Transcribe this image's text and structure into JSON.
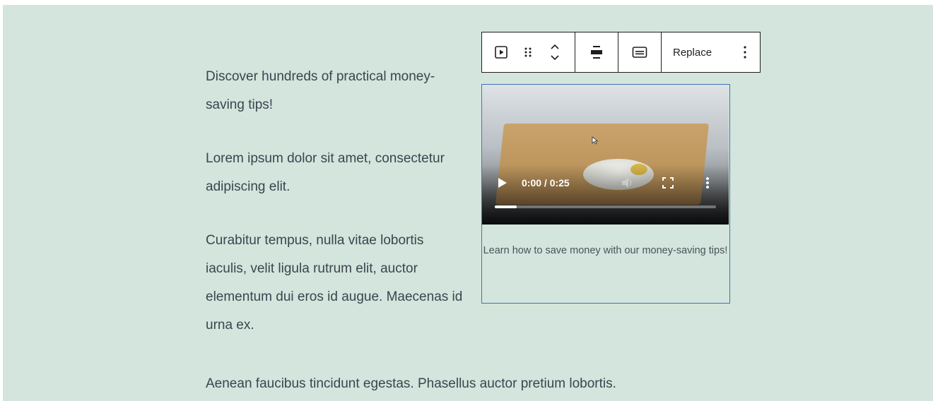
{
  "content": {
    "paragraphs": [
      "Discover hundreds of practical money-saving tips!",
      "Lorem ipsum dolor sit amet, consectetur adipiscing elit.",
      "Curabitur tempus, nulla vitae lobortis iaculis, velit ligula rutrum elit, auctor elementum dui eros id augue. Maecenas id urna ex."
    ],
    "bottom_paragraph": "Aenean faucibus tincidunt egestas. Phasellus auctor pretium lobortis."
  },
  "toolbar": {
    "block_type_icon": "video-icon",
    "drag_icon": "drag-handle-icon",
    "move_icon": "move-up-down-icon",
    "align_icon": "align-icon",
    "caption_icon": "caption-icon",
    "replace_label": "Replace",
    "options_icon": "more-options-icon"
  },
  "video": {
    "time_display": "0:00 / 0:25",
    "progress": 0.1,
    "caption": "Learn how to save money with our money-saving tips!",
    "icons": [
      "play-icon",
      "volume-icon",
      "fullscreen-icon",
      "more-vertical-icon",
      "cursor-icon"
    ]
  },
  "colors": {
    "background": "#d3e5dc",
    "selection_border": "#3f76b8",
    "text": "#3c4450"
  }
}
